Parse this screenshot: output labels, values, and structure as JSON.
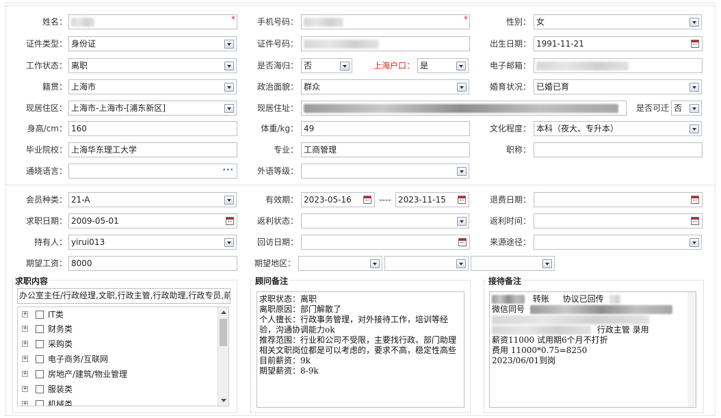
{
  "form": {
    "name_label": "姓名：",
    "phone_label": "手机号码：",
    "gender_label": "性别：",
    "gender_value": "女",
    "id_type_label": "证件类型：",
    "id_type_value": "身份证",
    "id_no_label": "证件号码：",
    "birth_label": "出生日期：",
    "birth_value": "1991-11-21",
    "work_status_label": "工作状态：",
    "work_status_value": "离职",
    "returnee_label": "是否海归：",
    "returnee_value": "否",
    "shanghai_hukou_label": "上海户口：",
    "shanghai_hukou_value": "是",
    "email_label": "电子邮箱：",
    "native_label": "籍贯：",
    "native_value": "上海市",
    "political_label": "政治面貌：",
    "political_value": "群众",
    "marital_label": "婚育状况：",
    "marital_value": "已婚已育",
    "residence_label": "现居住区：",
    "residence_value": "上海市-上海市-[浦东新区]",
    "address_label": "现居住址：",
    "relocate_label": "是否可迁",
    "relocate_value": "否",
    "height_label": "身高/cm：",
    "height_value": "160",
    "weight_label": "体重/kg：",
    "weight_value": "49",
    "education_label": "文化程度：",
    "education_value": "本科（夜大、专升本）",
    "school_label": "毕业院校：",
    "school_value": "上海华东理工大学",
    "major_label": "专业：",
    "major_value": "工商管理",
    "title_label": "职称：",
    "language_label": "通晓语言：",
    "foreign_level_label": "外语等级："
  },
  "member": {
    "type_label": "会员种类：",
    "type_value": "21-A",
    "validity_label": "有效期：",
    "validity_start": "2023-05-16",
    "validity_sep": "----",
    "validity_end": "2023-11-15",
    "refund_date_label": "退费日期：",
    "apply_date_label": "求职日期：",
    "apply_date_value": "2009-05-01",
    "rebate_status_label": "返利状态：",
    "rebate_time_label": "返利时间：",
    "holder_label": "持有人：",
    "holder_value": "yirui013",
    "visit_date_label": "回访日期：",
    "source_label": "来源途径：",
    "salary_label": "期望工资：",
    "salary_value": "8000",
    "area_label": "期望地区："
  },
  "job_panel": {
    "title": "求职内容",
    "summary": "办公室主任/行政经理,文职,行政主管,行政助理,行政专员,前",
    "items": [
      "IT类",
      "财务类",
      "采购类",
      "电子商务/互联网",
      "房地产/建筑/物业管理",
      "服装类",
      "机械类"
    ]
  },
  "advisor_panel": {
    "title": "顾问备注",
    "lines": [
      "求职状态：离职",
      "离职原因：部门解散了",
      "个人擅长：行政事务管理，对外接待工作，培训等经",
      "验，沟通协调能力ok",
      "推荐范围：行业和公司不受限，主要找行政、部门助理",
      "相关文职岗位都是可以考虑的，要求不高，稳定性高些",
      "目前薪资：9k",
      "期望薪资：8-9k"
    ]
  },
  "reception_panel": {
    "title": "接待备注",
    "line1_a": "转账",
    "line1_b": "协议已回传",
    "line2": "微信同号",
    "line4": "行政主管  录用",
    "line5": "薪资11000  试用期6个月不打折",
    "line6": "费用 11000*0.75=8250",
    "line7": "2023/06/01到岗"
  }
}
